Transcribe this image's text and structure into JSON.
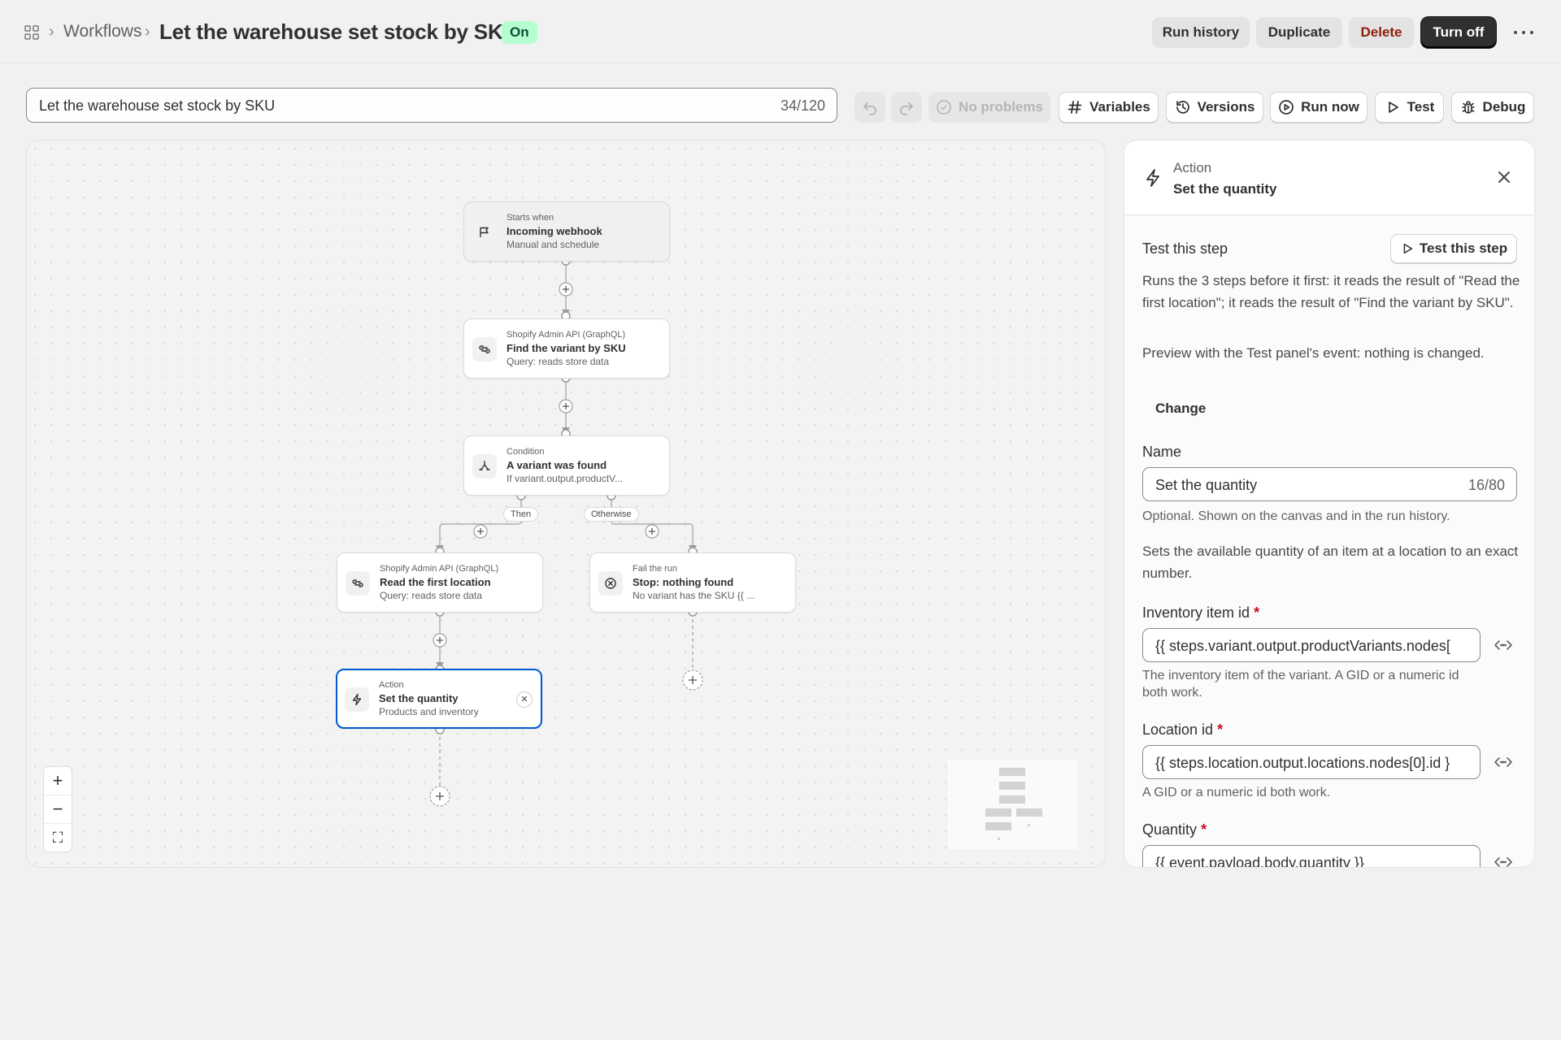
{
  "header": {
    "breadcrumb_parent": "Workflows",
    "title": "Let the warehouse set stock by SKU",
    "status": "On",
    "buttons": {
      "run_history": "Run history",
      "duplicate": "Duplicate",
      "delete": "Delete",
      "turn_off": "Turn off"
    }
  },
  "toolbar": {
    "title_value": "Let the warehouse set stock by SKU",
    "title_count": "34/120",
    "no_problems": "No problems",
    "variables": "Variables",
    "versions": "Versions",
    "run_now": "Run now",
    "test": "Test",
    "debug": "Debug"
  },
  "canvas": {
    "nodes": [
      {
        "caption": "Starts when",
        "title": "Incoming webhook",
        "sub": "Manual and schedule"
      },
      {
        "caption": "Shopify Admin API (GraphQL)",
        "title": "Find the variant by SKU",
        "sub": "Query: reads store data"
      },
      {
        "caption": "Condition",
        "title": "A variant was found",
        "sub": "If variant.output.productV..."
      },
      {
        "caption": "Shopify Admin API (GraphQL)",
        "title": "Read the first location",
        "sub": "Query: reads store data"
      },
      {
        "caption": "Fail the run",
        "title": "Stop: nothing found",
        "sub": "No variant has the SKU {{ ..."
      },
      {
        "caption": "Action",
        "title": "Set the quantity",
        "sub": "Products and inventory"
      }
    ],
    "branch_then": "Then",
    "branch_otherwise": "Otherwise",
    "zoom_in": "+",
    "zoom_out": "−",
    "fit": "⛶"
  },
  "panel": {
    "caption": "Action",
    "title": "Set the quantity",
    "test_heading": "Test this step",
    "test_button": "Test this step",
    "test_desc": "Runs the 3 steps before it first: it reads the result of \"Read the first location\"; it reads the result of \"Find the variant by SKU\".",
    "preview_desc": "Preview with the Test panel's event: nothing is changed.",
    "change": "Change",
    "name_label": "Name",
    "name_value": "Set the quantity",
    "name_count": "16/80",
    "name_help": "Optional. Shown on the canvas and in the run history.",
    "action_desc": "Sets the available quantity of an item at a location to an exact number.",
    "inventory_label": "Inventory item id",
    "inventory_value": "{{ steps.variant.output.productVariants.nodes[",
    "inventory_help": "The inventory item of the variant. A GID or a numeric id both work.",
    "location_label": "Location id",
    "location_value": "{{ steps.location.output.locations.nodes[0].id }",
    "location_help": "A GID or a numeric id both work.",
    "quantity_label": "Quantity",
    "quantity_value": "{{ event.payload.body.quantity }}",
    "required_mark": "*"
  },
  "colors": {
    "accent": "#005bd3",
    "status_bg": "#b4fed2",
    "danger": "#8e1f0b"
  },
  "icons": [
    "apps-icon",
    "flag-icon",
    "graphql-icon",
    "branch-icon",
    "x-circle-icon",
    "bolt-icon",
    "undo-icon",
    "redo-icon",
    "check-circle-icon",
    "hash-icon",
    "history-icon",
    "play-circle-icon",
    "play-icon",
    "bug-icon",
    "close-icon",
    "variable-icon",
    "more-icon"
  ]
}
